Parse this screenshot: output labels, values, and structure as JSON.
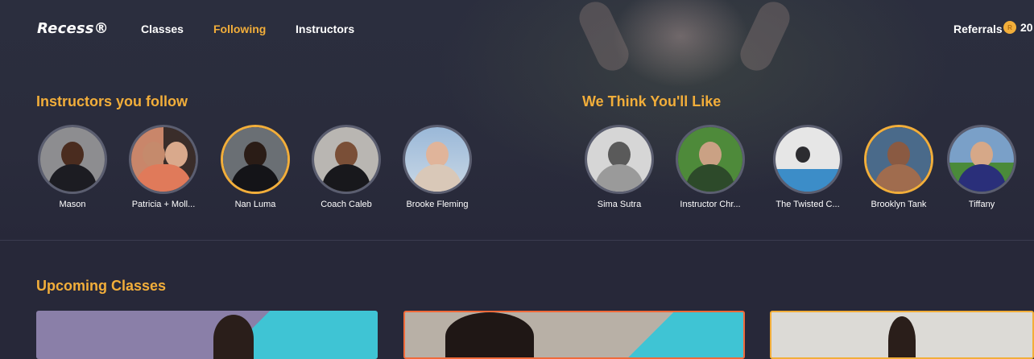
{
  "nav": {
    "logo": "Recess®",
    "items": [
      {
        "label": "Classes",
        "active": false
      },
      {
        "label": "Following",
        "active": true
      },
      {
        "label": "Instructors",
        "active": false
      }
    ],
    "referrals": "Referrals",
    "coin_value": "20"
  },
  "colors": {
    "accent": "#f2ae3a",
    "background": "#272839"
  },
  "following": {
    "title": "Instructors you follow",
    "instructors": [
      {
        "name": "Mason"
      },
      {
        "name": "Patricia + Moll..."
      },
      {
        "name": "Nan Luma"
      },
      {
        "name": "Coach Caleb"
      },
      {
        "name": "Brooke Fleming"
      }
    ]
  },
  "suggested": {
    "title": "We Think You'll Like",
    "instructors": [
      {
        "name": "Sima Sutra"
      },
      {
        "name": "Instructor Chr..."
      },
      {
        "name": "The Twisted C..."
      },
      {
        "name": "Brooklyn Tank"
      },
      {
        "name": "Tiffany"
      }
    ]
  },
  "upcoming": {
    "title": "Upcoming Classes"
  }
}
